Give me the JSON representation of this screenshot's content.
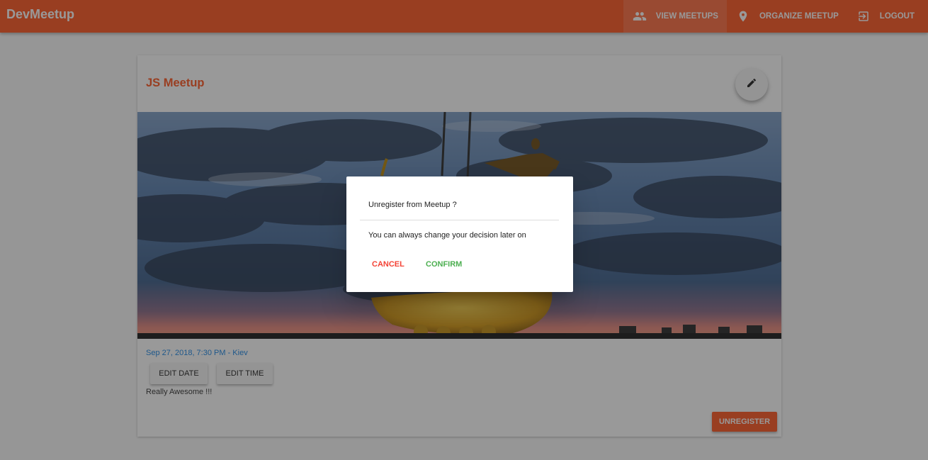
{
  "app": {
    "brand": "DevMeetup",
    "accent": "#ff5722"
  },
  "nav": [
    {
      "label": "VIEW MEETUPS",
      "icon": "people-icon",
      "active": true
    },
    {
      "label": "ORGANIZE MEETUP",
      "icon": "location-pin-icon",
      "active": false
    },
    {
      "label": "LOGOUT",
      "icon": "exit-icon",
      "active": false
    }
  ],
  "meetup": {
    "title": "JS Meetup",
    "edit_icon": "pencil-icon",
    "image_description": "Kiev monument statue at dusk with cloudy sky",
    "datetime_location": "Sep 27, 2018, 7:30 PM - Kiev",
    "edit_date_label": "EDIT DATE",
    "edit_time_label": "EDIT TIME",
    "description": "Really Awesome !!!",
    "unregister_label": "UNREGISTER"
  },
  "dialog": {
    "title": "Unregister from Meetup ?",
    "text": "You can always change your decision later on",
    "cancel_label": "CANCEL",
    "confirm_label": "CONFIRM",
    "cancel_color": "#f44336",
    "confirm_color": "#4caf50"
  }
}
